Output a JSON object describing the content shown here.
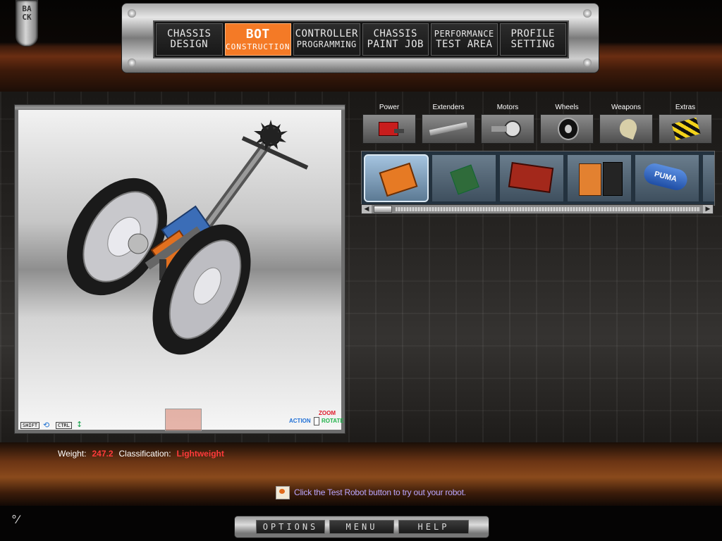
{
  "back_button": {
    "label": "BACK"
  },
  "nav_tabs": [
    {
      "line1": "CHASSIS",
      "line2": "DESIGN",
      "active": false
    },
    {
      "line1": "BOT",
      "line2": "CONSTRUCTION",
      "active": true
    },
    {
      "line1": "CONTROLLER",
      "line2": "PROGRAMMING",
      "active": false
    },
    {
      "line1": "CHASSIS",
      "line2": "PAINT JOB",
      "active": false
    },
    {
      "line1": "PERFORMANCE",
      "line2": "TEST AREA",
      "active": false
    },
    {
      "line1": "PROFILE",
      "line2": "SETTING",
      "active": false
    }
  ],
  "viewport": {
    "key_shift": "SHIFT",
    "key_ctrl": "CTRL",
    "action_label": "ACTION",
    "zoom_label": "ZOOM",
    "rotate_label": "ROTATE"
  },
  "status": {
    "weight_label": "Weight:",
    "weight_value": "247.2",
    "class_label": "Classification:",
    "class_value": "Lightweight"
  },
  "categories": [
    {
      "label": "Power",
      "icon": "battery-icon"
    },
    {
      "label": "Extenders",
      "icon": "extender-bar-icon"
    },
    {
      "label": "Motors",
      "icon": "motor-icon"
    },
    {
      "label": "Wheels",
      "icon": "wheel-icon"
    },
    {
      "label": "Weapons",
      "icon": "blade-icon"
    },
    {
      "label": "Extras",
      "icon": "hazard-plate-icon"
    }
  ],
  "parts": [
    {
      "icon": "orange-controller-board-icon",
      "selected": true
    },
    {
      "icon": "green-circuit-board-icon",
      "selected": false
    },
    {
      "icon": "red-battery-pack-icon",
      "selected": false
    },
    {
      "icon": "orange-battery-cells-icon",
      "selected": false
    },
    {
      "icon": "puma-motor-icon",
      "selected": false,
      "text": "PUMA"
    }
  ],
  "tip": {
    "text": "Click the Test Robot button to try out your robot."
  },
  "bottom_menu": [
    {
      "label": "OPTIONS"
    },
    {
      "label": "MENU"
    },
    {
      "label": "HELP"
    }
  ],
  "colors": {
    "accent": "#f47a26",
    "status_value": "#ff3a3a",
    "tip_text": "#b9a6ff"
  }
}
